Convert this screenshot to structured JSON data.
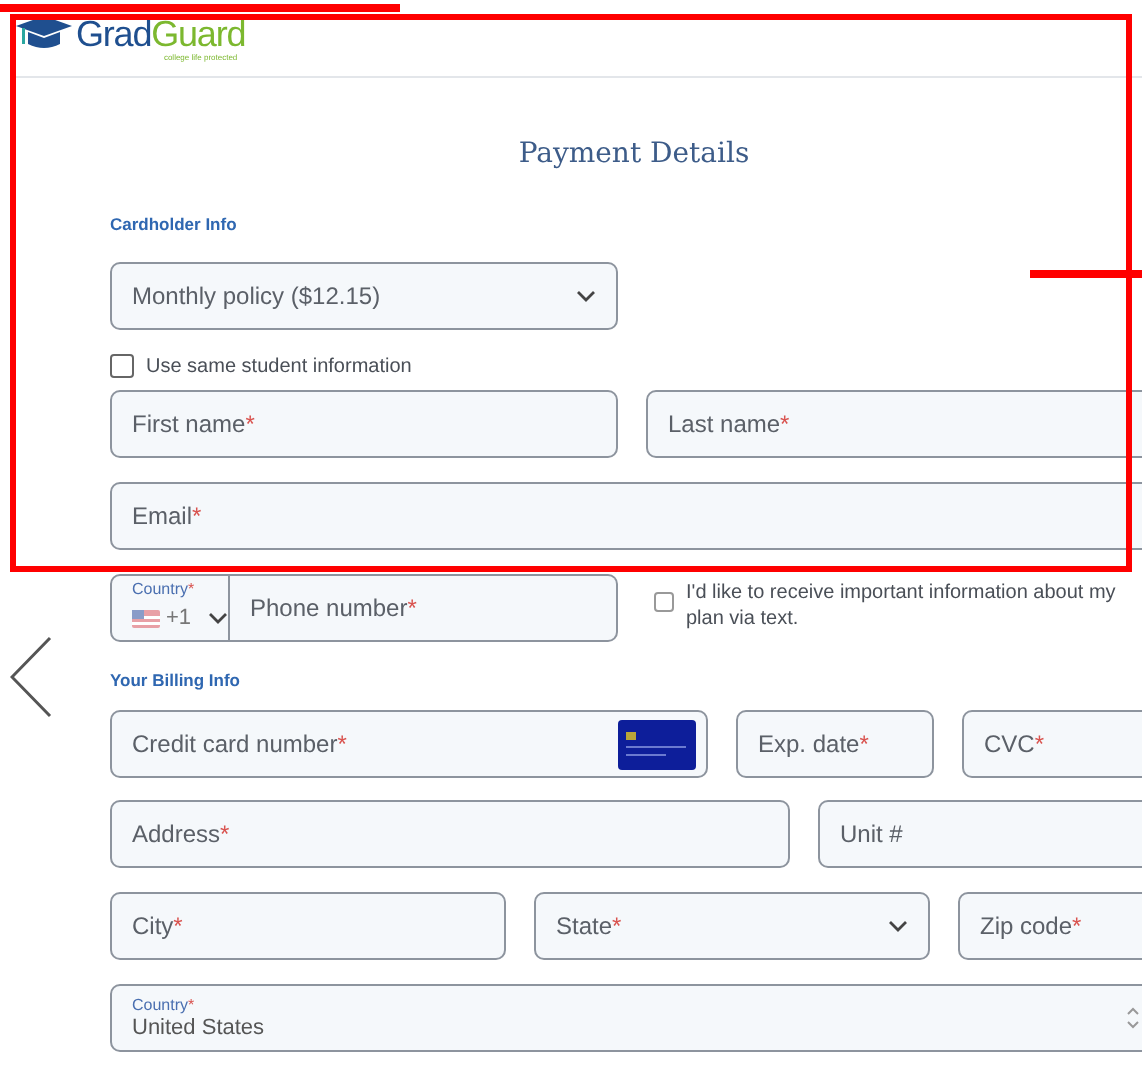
{
  "header": {
    "logo": [
      {
        "text": "Grad",
        "color": "#1f4f8f"
      },
      {
        "text": "Guard",
        "color": "#7cb82f"
      }
    ],
    "tagline": "college life protected"
  },
  "title": "Payment Details",
  "sections": [
    {
      "heading": "Cardholder Info",
      "rows": [
        [
          {
            "kind": "select",
            "value": "Monthly policy ($12.15)"
          }
        ],
        [
          {
            "kind": "checkbox",
            "label": "Use same student information",
            "checked": false
          }
        ],
        [
          {
            "kind": "text",
            "label": "First name",
            "mark": "*"
          },
          {
            "kind": "text",
            "label": "Last name",
            "mark": "*"
          }
        ],
        [
          {
            "kind": "text",
            "label": "Email",
            "mark": "*"
          }
        ],
        [
          {
            "kind": "phone",
            "country_label": "Country",
            "country_mark": "*",
            "code": "+1",
            "label": "Phone number",
            "mark": "*"
          },
          {
            "kind": "checkbox",
            "label": "I'd like to receive important information about my plan via text.",
            "checked": false
          }
        ]
      ]
    },
    {
      "heading": "Your Billing Info",
      "rows": [
        [
          {
            "kind": "card",
            "label": "Credit card number",
            "mark": "*"
          },
          {
            "kind": "text",
            "label": "Exp. date",
            "mark": "*"
          },
          {
            "kind": "text",
            "label": "CVC",
            "mark": "*"
          }
        ],
        [
          {
            "kind": "text",
            "label": "Address",
            "mark": "*"
          },
          {
            "kind": "text",
            "label": "Unit #"
          }
        ],
        [
          {
            "kind": "text",
            "label": "City",
            "mark": "*"
          },
          {
            "kind": "select",
            "value": "State",
            "mark": "*"
          },
          {
            "kind": "text",
            "label": "Zip code",
            "mark": "*"
          }
        ],
        [
          {
            "kind": "country",
            "label": "Country",
            "mark": "*",
            "value": "United States"
          }
        ]
      ]
    }
  ]
}
